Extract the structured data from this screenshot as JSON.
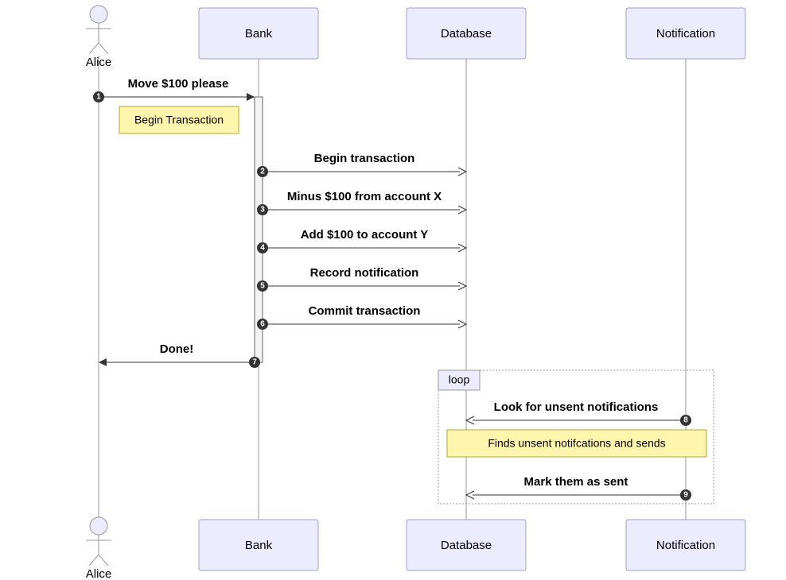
{
  "participants": {
    "alice": {
      "label": "Alice",
      "type": "actor"
    },
    "bank": {
      "label": "Bank",
      "type": "box"
    },
    "database": {
      "label": "Database",
      "type": "box"
    },
    "notification": {
      "label": "Notification",
      "type": "box"
    }
  },
  "messages": [
    {
      "n": 1,
      "from": "alice",
      "to": "bank",
      "label": "Move $100 please",
      "arrow": "solid"
    },
    {
      "n": 2,
      "from": "bank",
      "to": "database",
      "label": "Begin transaction",
      "arrow": "open"
    },
    {
      "n": 3,
      "from": "bank",
      "to": "database",
      "label": "Minus $100 from account X",
      "arrow": "open"
    },
    {
      "n": 4,
      "from": "bank",
      "to": "database",
      "label": "Add $100 to account Y",
      "arrow": "open"
    },
    {
      "n": 5,
      "from": "bank",
      "to": "database",
      "label": "Record notification",
      "arrow": "open"
    },
    {
      "n": 6,
      "from": "bank",
      "to": "database",
      "label": "Commit transaction",
      "arrow": "open"
    },
    {
      "n": 7,
      "from": "bank",
      "to": "alice",
      "label": "Done!",
      "arrow": "solid"
    },
    {
      "n": 8,
      "from": "notification",
      "to": "database",
      "label": "Look for unsent notifications",
      "arrow": "open"
    },
    {
      "n": 9,
      "from": "notification",
      "to": "database",
      "label": "Mark them as sent",
      "arrow": "open"
    }
  ],
  "notes": {
    "beginTx": "Begin Transaction",
    "findsUnsent": "Finds unsent notifcations and sends"
  },
  "fragments": {
    "loop": {
      "label": "loop"
    }
  },
  "chart_data": {
    "type": "sequence_diagram",
    "participants": [
      "Alice",
      "Bank",
      "Database",
      "Notification"
    ],
    "interactions": [
      {
        "seq": 1,
        "from": "Alice",
        "to": "Bank",
        "text": "Move $100 please",
        "sync": true
      },
      {
        "note_over": "Bank",
        "text": "Begin Transaction"
      },
      {
        "seq": 2,
        "from": "Bank",
        "to": "Database",
        "text": "Begin transaction",
        "sync": false
      },
      {
        "seq": 3,
        "from": "Bank",
        "to": "Database",
        "text": "Minus $100 from account X",
        "sync": false
      },
      {
        "seq": 4,
        "from": "Bank",
        "to": "Database",
        "text": "Add $100 to account Y",
        "sync": false
      },
      {
        "seq": 5,
        "from": "Bank",
        "to": "Database",
        "text": "Record notification",
        "sync": false
      },
      {
        "seq": 6,
        "from": "Bank",
        "to": "Database",
        "text": "Commit transaction",
        "sync": false
      },
      {
        "seq": 7,
        "from": "Bank",
        "to": "Alice",
        "text": "Done!",
        "sync": true
      },
      {
        "fragment": "loop",
        "contains": [
          {
            "seq": 8,
            "from": "Notification",
            "to": "Database",
            "text": "Look for unsent notifications",
            "sync": false
          },
          {
            "note_over": [
              "Database",
              "Notification"
            ],
            "text": "Finds unsent notifcations and sends"
          },
          {
            "seq": 9,
            "from": "Notification",
            "to": "Database",
            "text": "Mark them as sent",
            "sync": false
          }
        ]
      }
    ]
  }
}
